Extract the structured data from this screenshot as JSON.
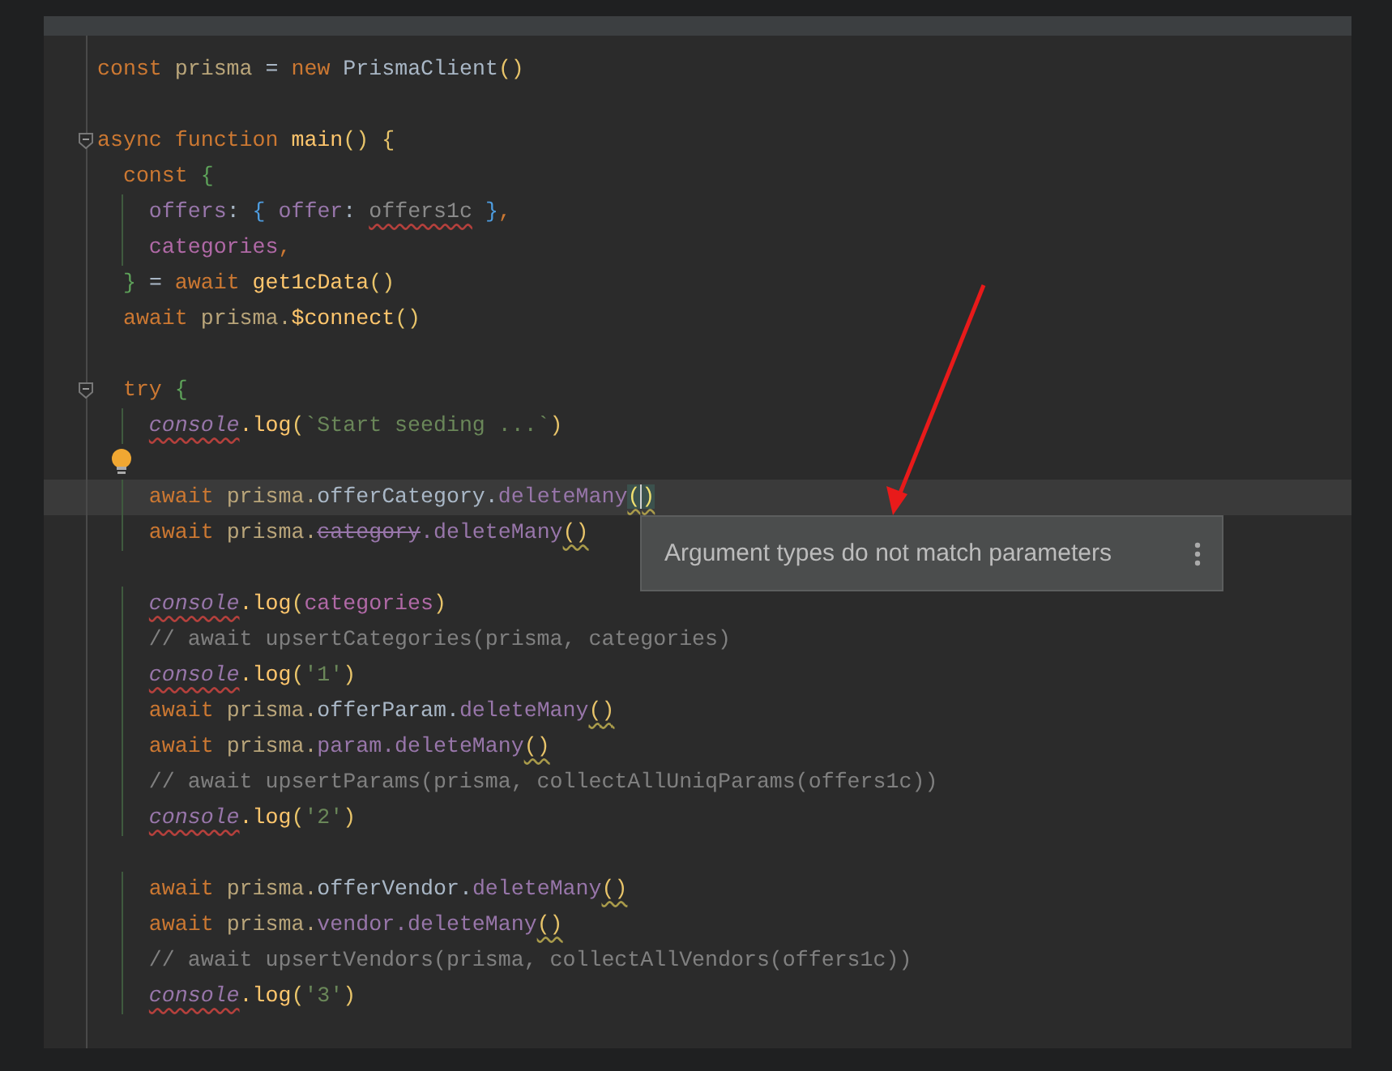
{
  "editor": {
    "lines": [
      {
        "kind": "code",
        "tokens": [
          {
            "text": "const",
            "kind": "keyword"
          },
          {
            "text": " prisma",
            "kind": "variable"
          },
          {
            "text": " = ",
            "kind": "plain"
          },
          {
            "text": "new",
            "kind": "keyword"
          },
          {
            "text": " PrismaClient",
            "kind": "plain"
          },
          {
            "text": "()",
            "kind": "paren"
          }
        ]
      },
      {
        "kind": "blank"
      },
      {
        "kind": "code",
        "fold": true,
        "tokens": [
          {
            "text": "async",
            "kind": "keyword"
          },
          {
            "text": " function",
            "kind": "keyword"
          },
          {
            "text": " main",
            "kind": "call"
          },
          {
            "text": "()",
            "kind": "paren"
          },
          {
            "text": " {",
            "kind": "paren"
          }
        ]
      },
      {
        "kind": "code",
        "tokens": [
          {
            "text": "  const",
            "kind": "keyword"
          },
          {
            "text": " {",
            "kind": "brace_green"
          }
        ]
      },
      {
        "kind": "code",
        "tokens": [
          {
            "text": "    offers",
            "kind": "property"
          },
          {
            "text": ": ",
            "kind": "plain"
          },
          {
            "text": "{",
            "kind": "brace_blue"
          },
          {
            "text": " offer",
            "kind": "property"
          },
          {
            "text": ": ",
            "kind": "plain"
          },
          {
            "text": "offers1c",
            "kind": "unresolved"
          },
          {
            "text": " }",
            "kind": "brace_blue"
          },
          {
            "text": ",",
            "kind": "keyword"
          }
        ]
      },
      {
        "kind": "code",
        "tokens": [
          {
            "text": "    categories",
            "kind": "local"
          },
          {
            "text": ",",
            "kind": "keyword"
          }
        ]
      },
      {
        "kind": "code",
        "tokens": [
          {
            "text": "  }",
            "kind": "brace_green"
          },
          {
            "text": " = ",
            "kind": "plain"
          },
          {
            "text": "await",
            "kind": "keyword"
          },
          {
            "text": " get1cData",
            "kind": "call"
          },
          {
            "text": "()",
            "kind": "paren"
          }
        ]
      },
      {
        "kind": "code",
        "tokens": [
          {
            "text": "  await",
            "kind": "keyword"
          },
          {
            "text": " prisma.",
            "kind": "variable"
          },
          {
            "text": "$connect",
            "kind": "call"
          },
          {
            "text": "()",
            "kind": "paren"
          }
        ]
      },
      {
        "kind": "blank"
      },
      {
        "kind": "code",
        "fold": true,
        "tokens": [
          {
            "text": "  try",
            "kind": "keyword"
          },
          {
            "text": " {",
            "kind": "brace_green"
          }
        ]
      },
      {
        "kind": "code",
        "tokens": [
          {
            "text": "    console",
            "kind": "console"
          },
          {
            "text": ".log",
            "kind": "call"
          },
          {
            "text": "(",
            "kind": "paren"
          },
          {
            "text": "`Start seeding ...`",
            "kind": "string"
          },
          {
            "text": ")",
            "kind": "paren"
          }
        ]
      },
      {
        "kind": "blank",
        "bulb": true
      },
      {
        "kind": "code",
        "current": true,
        "tokens": [
          {
            "text": "    await",
            "kind": "keyword"
          },
          {
            "text": " prisma.",
            "kind": "variable"
          },
          {
            "text": "offerCategory.",
            "kind": "plain"
          },
          {
            "text": "deleteMany",
            "kind": "property"
          },
          {
            "text": "()",
            "kind": "cursor_paren"
          }
        ]
      },
      {
        "kind": "code",
        "tokens": [
          {
            "text": "    await",
            "kind": "keyword"
          },
          {
            "text": " prisma.",
            "kind": "variable"
          },
          {
            "text": "category",
            "kind": "deprecated"
          },
          {
            "text": ".deleteMany",
            "kind": "property"
          },
          {
            "text": "()",
            "kind": "warn_paren"
          }
        ]
      },
      {
        "kind": "blank"
      },
      {
        "kind": "code",
        "tokens": [
          {
            "text": "    console",
            "kind": "console"
          },
          {
            "text": ".log",
            "kind": "call"
          },
          {
            "text": "(",
            "kind": "paren"
          },
          {
            "text": "categories",
            "kind": "local"
          },
          {
            "text": ")",
            "kind": "paren"
          }
        ]
      },
      {
        "kind": "code",
        "tokens": [
          {
            "text": "    // await upsertCategories(prisma, categories)",
            "kind": "comment"
          }
        ]
      },
      {
        "kind": "code",
        "tokens": [
          {
            "text": "    console",
            "kind": "console"
          },
          {
            "text": ".log",
            "kind": "call"
          },
          {
            "text": "(",
            "kind": "paren"
          },
          {
            "text": "'1'",
            "kind": "string"
          },
          {
            "text": ")",
            "kind": "paren"
          }
        ]
      },
      {
        "kind": "code",
        "tokens": [
          {
            "text": "    await",
            "kind": "keyword"
          },
          {
            "text": " prisma.",
            "kind": "variable"
          },
          {
            "text": "offerParam.",
            "kind": "plain"
          },
          {
            "text": "deleteMany",
            "kind": "property"
          },
          {
            "text": "()",
            "kind": "warn_paren"
          }
        ]
      },
      {
        "kind": "code",
        "tokens": [
          {
            "text": "    await",
            "kind": "keyword"
          },
          {
            "text": " prisma.",
            "kind": "variable"
          },
          {
            "text": "param.deleteMany",
            "kind": "property"
          },
          {
            "text": "()",
            "kind": "warn_paren"
          }
        ]
      },
      {
        "kind": "code",
        "tokens": [
          {
            "text": "    // await upsertParams(prisma, collectAllUniqParams(offers1c))",
            "kind": "comment"
          }
        ]
      },
      {
        "kind": "code",
        "tokens": [
          {
            "text": "    console",
            "kind": "console"
          },
          {
            "text": ".log",
            "kind": "call"
          },
          {
            "text": "(",
            "kind": "paren"
          },
          {
            "text": "'2'",
            "kind": "string"
          },
          {
            "text": ")",
            "kind": "paren"
          }
        ]
      },
      {
        "kind": "blank"
      },
      {
        "kind": "code",
        "tokens": [
          {
            "text": "    await",
            "kind": "keyword"
          },
          {
            "text": " prisma.",
            "kind": "variable"
          },
          {
            "text": "offerVendor.",
            "kind": "plain"
          },
          {
            "text": "deleteMany",
            "kind": "property"
          },
          {
            "text": "()",
            "kind": "warn_paren"
          }
        ]
      },
      {
        "kind": "code",
        "tokens": [
          {
            "text": "    await",
            "kind": "keyword"
          },
          {
            "text": " prisma.",
            "kind": "variable"
          },
          {
            "text": "vendor.deleteMany",
            "kind": "property"
          },
          {
            "text": "()",
            "kind": "warn_paren"
          }
        ]
      },
      {
        "kind": "code",
        "tokens": [
          {
            "text": "    // await upsertVendors(prisma, collectAllVendors(offers1c))",
            "kind": "comment"
          }
        ]
      },
      {
        "kind": "code",
        "tokens": [
          {
            "text": "    console",
            "kind": "console"
          },
          {
            "text": ".log",
            "kind": "call"
          },
          {
            "text": "(",
            "kind": "paren"
          },
          {
            "text": "'3'",
            "kind": "string"
          },
          {
            "text": ")",
            "kind": "paren"
          }
        ]
      }
    ]
  },
  "tooltip": {
    "message": "Argument types do not match parameters"
  }
}
